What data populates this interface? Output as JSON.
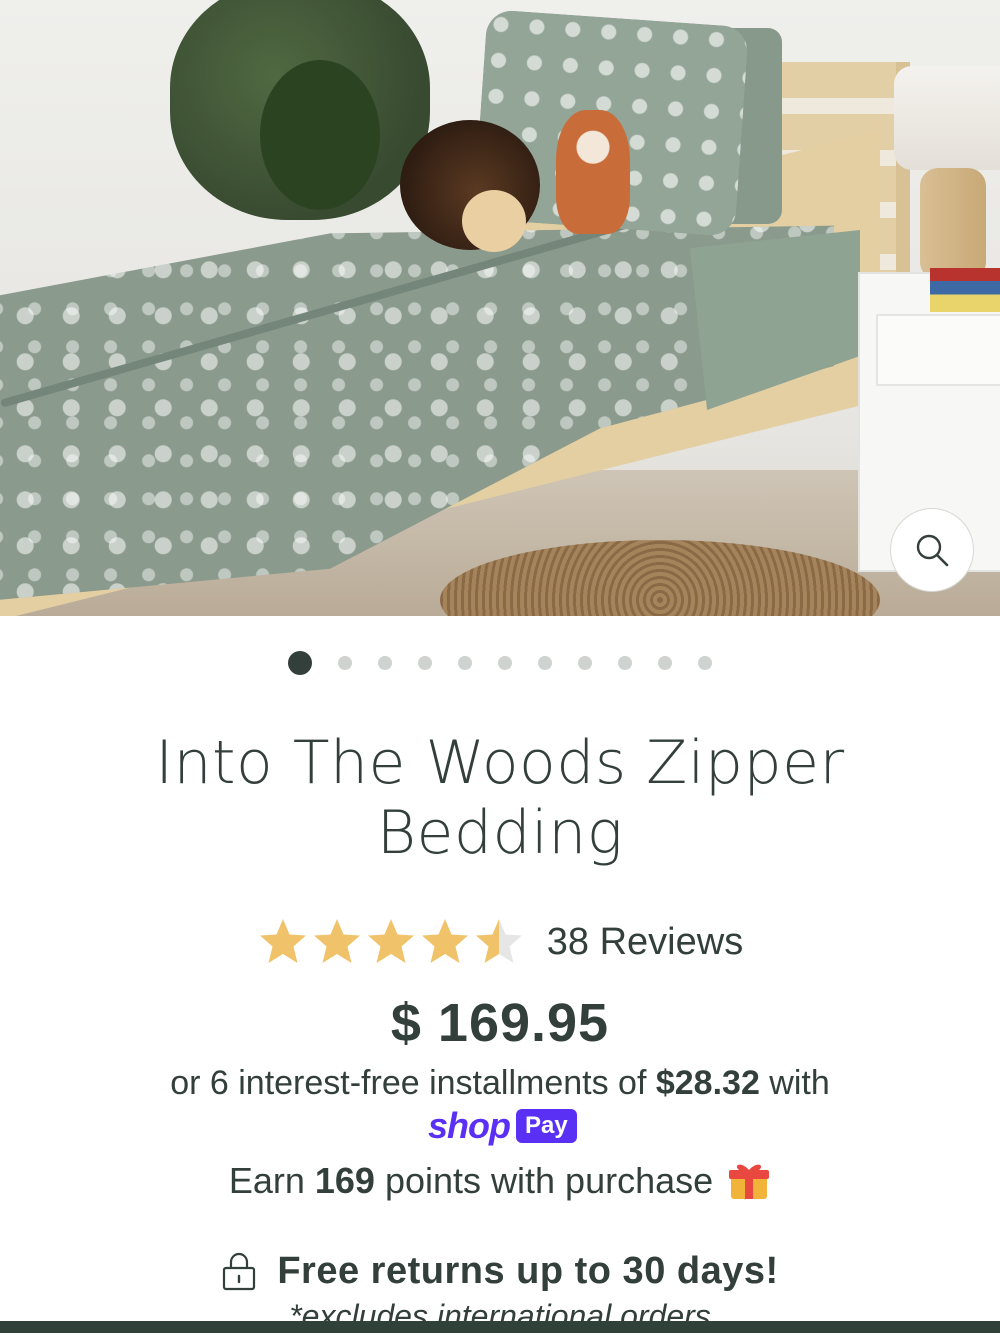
{
  "product": {
    "title": "Into The Woods Zipper Bedding",
    "rating_value": 4.5,
    "rating_max": 5,
    "reviews_label": "38 Reviews",
    "price": "$ 169.95"
  },
  "carousel": {
    "total_images": 11,
    "active_index": 0
  },
  "installments": {
    "prefix": "or 6 interest-free installments of ",
    "amount": "$28.32",
    "suffix": " with",
    "provider_word": "shop",
    "provider_badge": "Pay"
  },
  "rewards": {
    "prefix": "Earn",
    "points": "169",
    "suffix": "points with purchase"
  },
  "returns": {
    "headline": "Free returns up to 30 days!",
    "note": "*excludes international orders"
  },
  "icons": {
    "zoom": "magnifier-icon",
    "star": "star-icon",
    "gift": "gift-icon",
    "lock": "lock-icon"
  },
  "colors": {
    "text": "#333f3a",
    "star": "#f0c36b",
    "star_empty": "#e6e6e6",
    "shop_pay": "#5a31f4",
    "footer_bar": "#2f4138"
  }
}
